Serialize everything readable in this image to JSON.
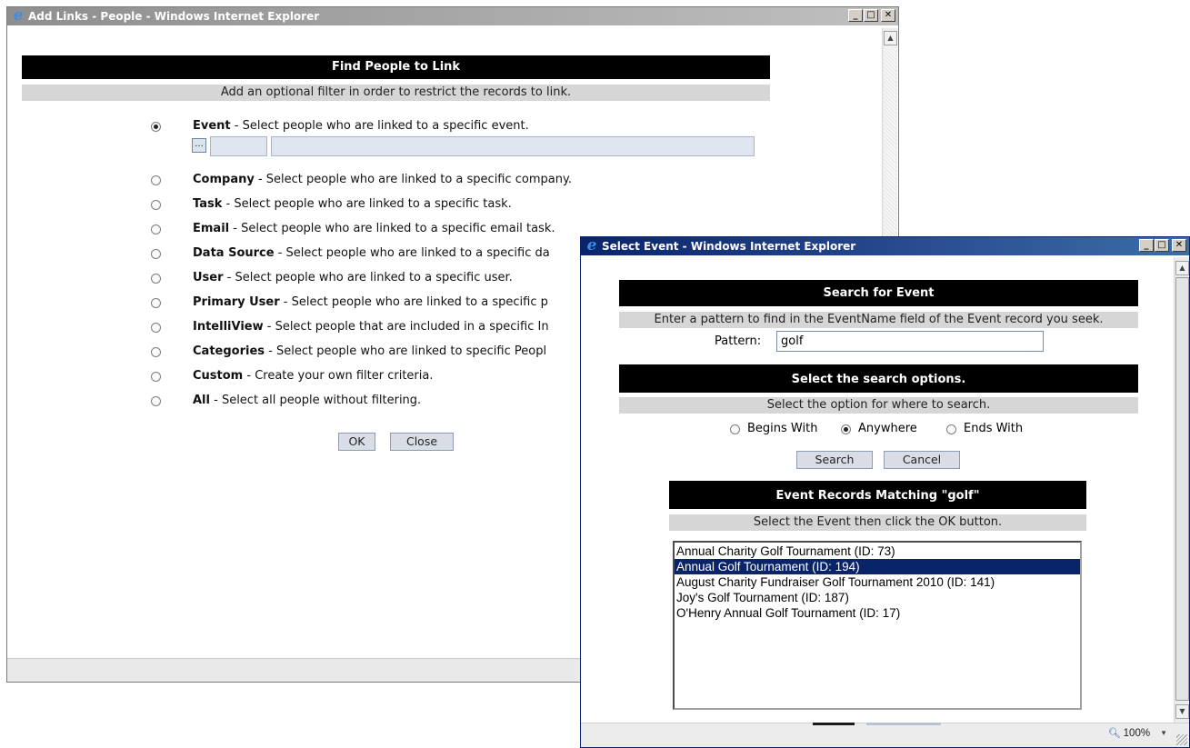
{
  "add_links_window": {
    "title": "Add Links - People - Windows Internet Explorer",
    "heading": "Find People to Link",
    "subheading": "Add an optional filter in order to restrict the records to link.",
    "options": [
      {
        "name": "Event",
        "desc": " - Select people who are linked to a specific event.",
        "checked": true
      },
      {
        "name": "Company",
        "desc": " - Select people who are linked to a specific company.",
        "checked": false
      },
      {
        "name": "Task",
        "desc": " - Select people who are linked to a specific task.",
        "checked": false
      },
      {
        "name": "Email",
        "desc": " - Select people who are linked to a specific email task.",
        "checked": false
      },
      {
        "name": "Data Source",
        "desc": " - Select people who are linked to a specific da",
        "checked": false
      },
      {
        "name": "User",
        "desc": " - Select people who are linked to a specific user.",
        "checked": false
      },
      {
        "name": "Primary User",
        "desc": " - Select people who are linked to a specific p",
        "checked": false
      },
      {
        "name": "IntelliView",
        "desc": " - Select people that are included in a specific In",
        "checked": false
      },
      {
        "name": "Categories",
        "desc": " - Select people who are linked to specific Peopl",
        "checked": false
      },
      {
        "name": "Custom",
        "desc": " - Create your own filter criteria.",
        "checked": false
      },
      {
        "name": "All",
        "desc": " - Select all people without filtering.",
        "checked": false
      }
    ],
    "browse_button": "...",
    "event_id_value": "",
    "event_name_value": "",
    "ok_label": "OK",
    "close_label": "Close"
  },
  "select_event_window": {
    "title": "Select Event - Windows Internet Explorer",
    "search_heading": "Search for Event",
    "search_instruction": "Enter a pattern to find in the EventName field of the Event record you seek.",
    "pattern_label": "Pattern:",
    "pattern_value": "golf",
    "options_heading": "Select the search options.",
    "options_instruction": "Select the option for where to search.",
    "search_options": [
      {
        "label": "Begins With",
        "checked": false
      },
      {
        "label": "Anywhere",
        "checked": true
      },
      {
        "label": "Ends With",
        "checked": false
      }
    ],
    "search_label": "Search",
    "cancel_label": "Cancel",
    "results_heading": "Event Records Matching \"golf\"",
    "results_instruction": "Select the Event then click the OK button.",
    "results": [
      {
        "text": "Annual Charity Golf Tournament (ID: 73)",
        "selected": false
      },
      {
        "text": "Annual Golf Tournament (ID: 194)",
        "selected": true
      },
      {
        "text": "August Charity Fundraiser Golf Tournament 2010 (ID: 141)",
        "selected": false
      },
      {
        "text": "Joy's Golf Tournament (ID: 187)",
        "selected": false
      },
      {
        "text": "O'Henry Annual Golf Tournament (ID: 17)",
        "selected": false
      }
    ],
    "zoom_level": "100%"
  },
  "colors": {
    "active_title": "#0a246a",
    "inactive_title": "#8e8e8e",
    "selection": "#0a246a",
    "header_bar": "#000000",
    "subheader_bar": "#d6d6d6"
  }
}
